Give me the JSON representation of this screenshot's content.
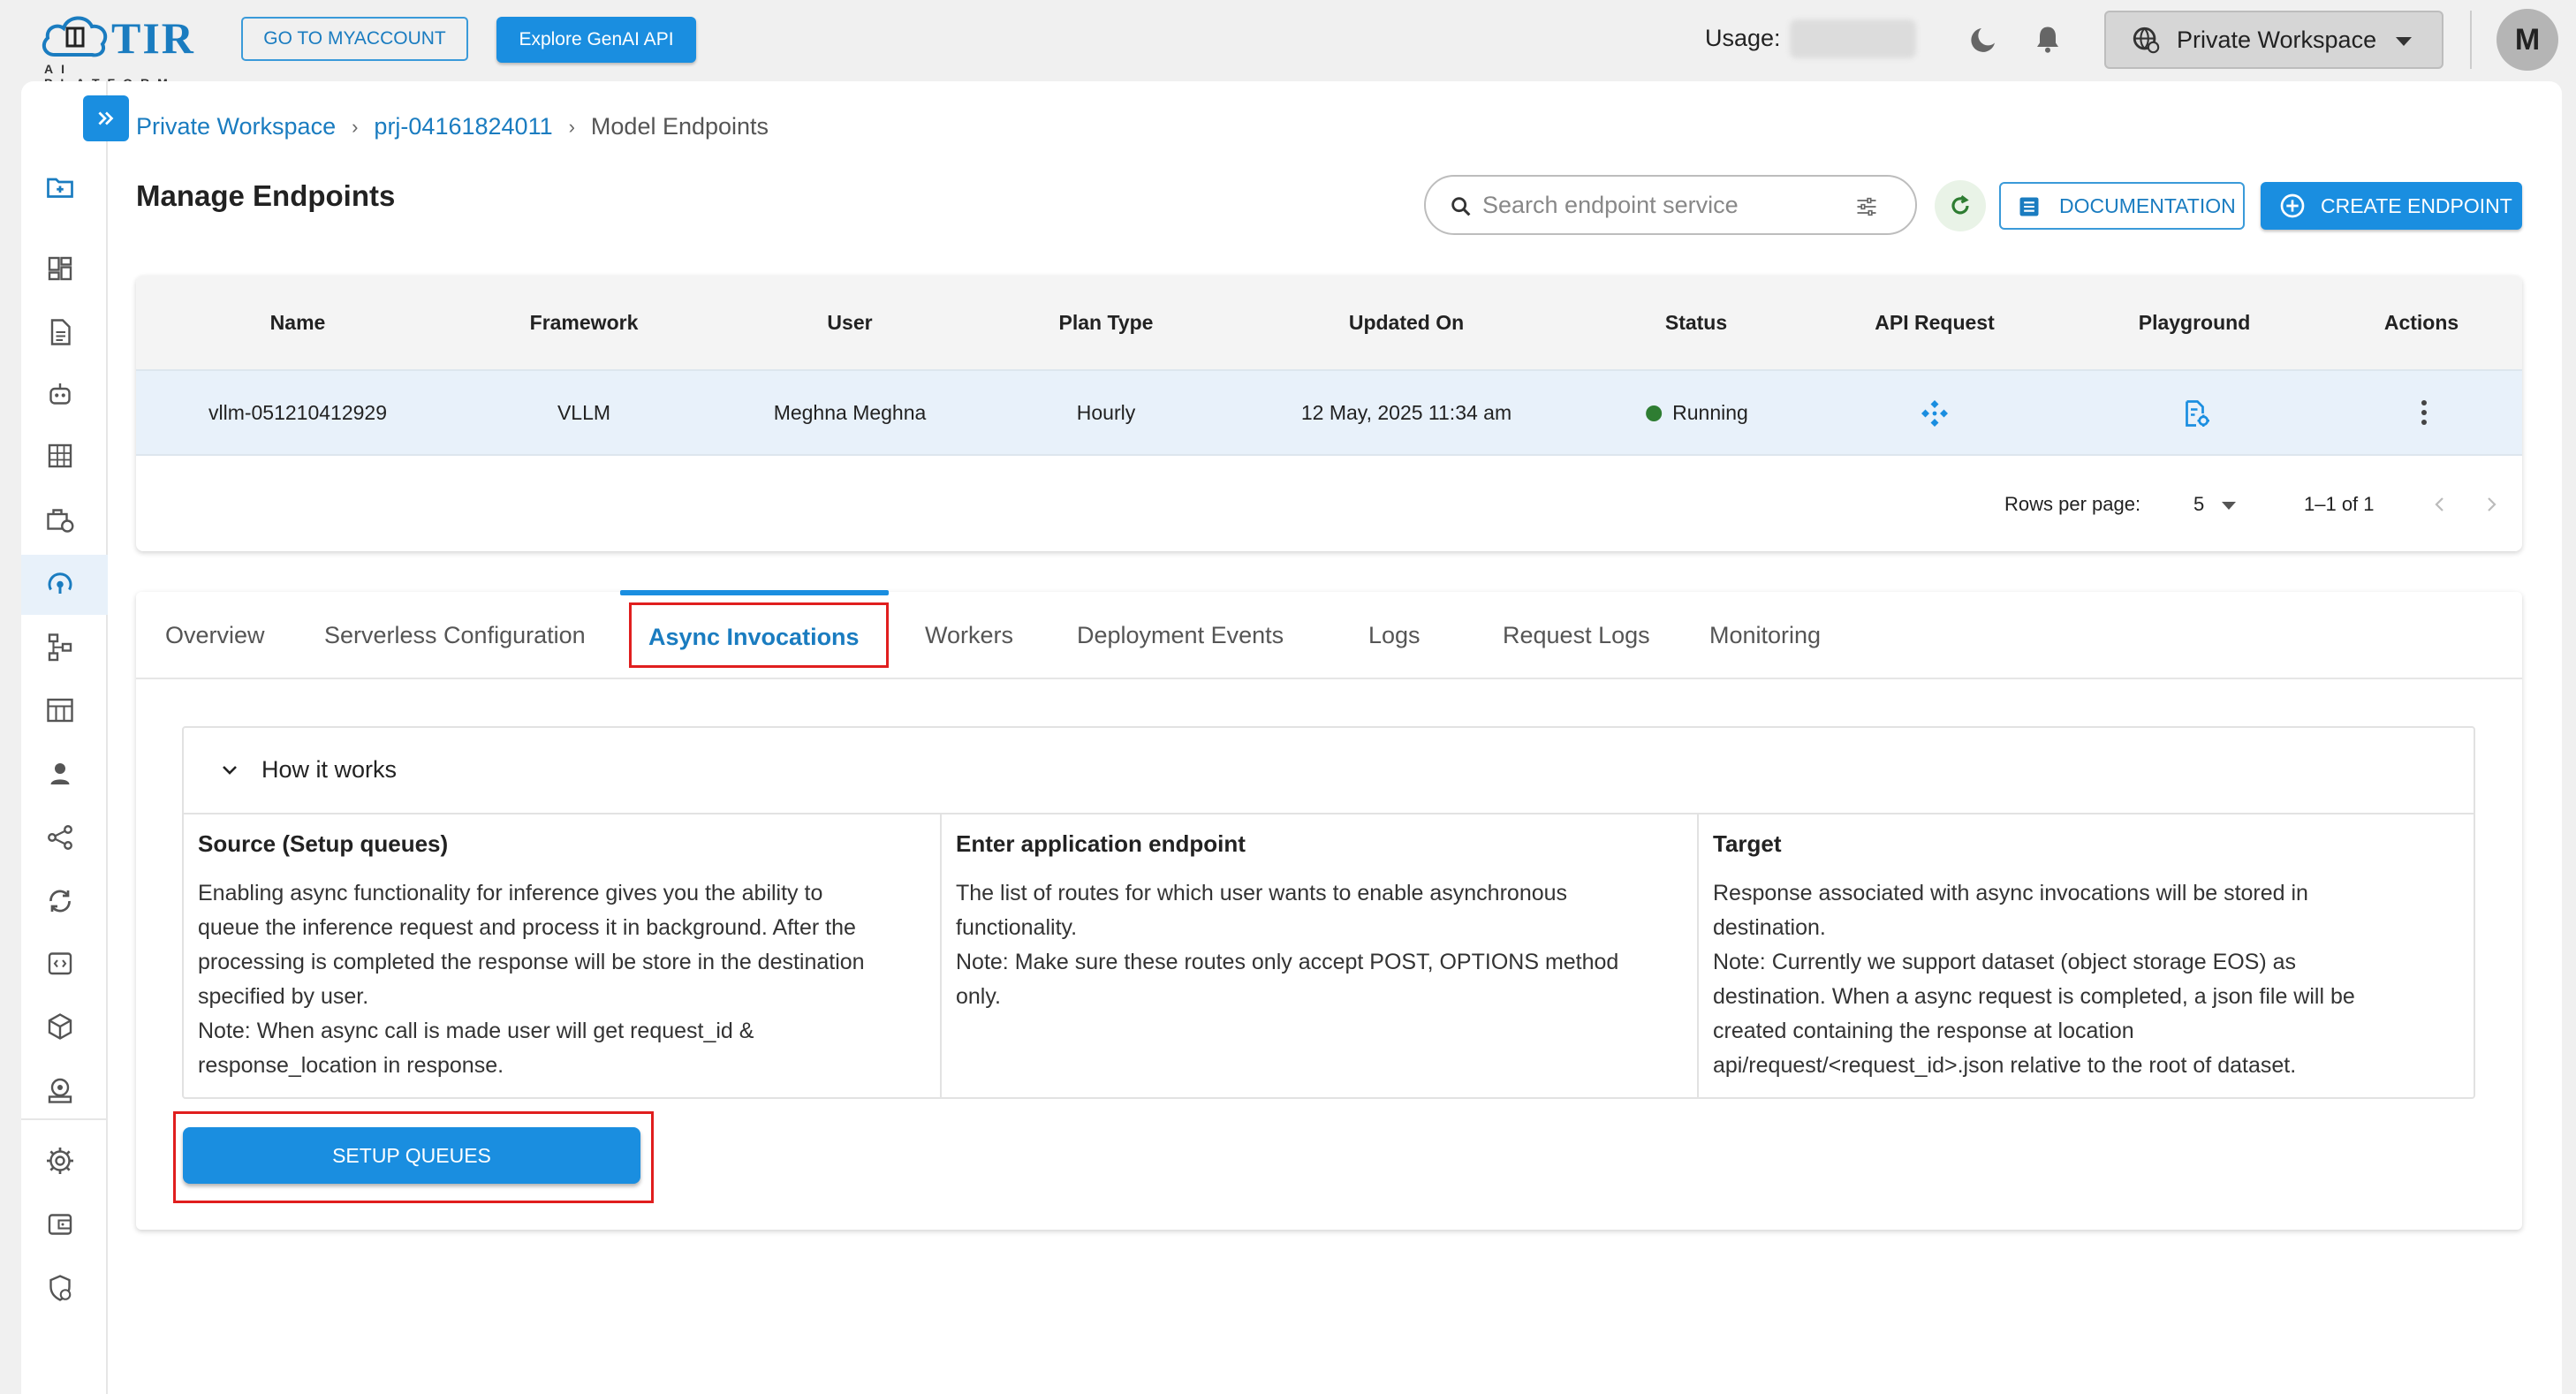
{
  "brand": {
    "name": "TIR",
    "subtitle": "AI PLATFORM"
  },
  "topbar": {
    "myaccount_label": "GO TO MYACCOUNT",
    "genai_label": "Explore GenAI API",
    "usage_label": "Usage:",
    "workspace_label": "Private Workspace",
    "avatar_initial": "M"
  },
  "breadcrumb": {
    "items": [
      "Private Workspace",
      "prj-04161824011",
      "Model Endpoints"
    ],
    "separator": "›"
  },
  "page": {
    "title": "Manage Endpoints"
  },
  "toolbar": {
    "search_placeholder": "Search endpoint service",
    "documentation_label": "DOCUMENTATION",
    "create_label": "CREATE ENDPOINT"
  },
  "table": {
    "headers": [
      "Name",
      "Framework",
      "User",
      "Plan Type",
      "Updated On",
      "Status",
      "API Request",
      "Playground",
      "Actions"
    ],
    "rows": [
      {
        "name": "vllm-051210412929",
        "framework": "VLLM",
        "user": "Meghna Meghna",
        "plan": "Hourly",
        "updated": "12 May, 2025 11:34 am",
        "status": "Running"
      }
    ],
    "pagination": {
      "rows_label": "Rows per page:",
      "rows_value": "5",
      "range": "1–1 of 1"
    }
  },
  "tabs": [
    {
      "label": "Overview"
    },
    {
      "label": "Serverless Configuration"
    },
    {
      "label": "Async Invocations",
      "active": true
    },
    {
      "label": "Workers"
    },
    {
      "label": "Deployment Events"
    },
    {
      "label": "Logs"
    },
    {
      "label": "Request Logs"
    },
    {
      "label": "Monitoring"
    }
  ],
  "how_it_works": {
    "title": "How it works",
    "columns": [
      {
        "title": "Source (Setup queues)",
        "lines": [
          "Enabling async functionality for inference gives you the ability to",
          "queue the inference request and process it in background. After the",
          "processing is completed the response will be store in the destination",
          "specified by user.",
          "Note: When async call is made user will get request_id &",
          "response_location in response."
        ]
      },
      {
        "title": "Enter application endpoint",
        "lines": [
          "The list of routes for which user wants to enable asynchronous",
          "functionality.",
          "Note: Make sure these routes only accept POST, OPTIONS method",
          "only."
        ]
      },
      {
        "title": "Target",
        "lines": [
          "Response associated with async invocations will be stored in",
          "destination.",
          "Note: Currently we support dataset (object storage EOS) as",
          "destination. When a async request is completed, a json file will be",
          "created containing the response at location",
          "api/request/<request_id>.json relative to the root of dataset."
        ]
      }
    ],
    "setup_label": "SETUP QUEUES"
  },
  "colors": {
    "accent": "#1a8ee0",
    "link": "#1a7cc0",
    "running": "#2e7d32",
    "highlight": "#e01e1e",
    "row_selected": "#e8f1fa"
  },
  "sidebar_icons": [
    "folder-plus-icon",
    "dashboard-icon",
    "document-icon",
    "robot-icon",
    "grid-icon",
    "toolbox-clock-icon",
    "endpoint-icon",
    "pipeline-icon",
    "table-icon",
    "user-stamp-icon",
    "share-nodes-icon",
    "sync-icon",
    "code-box-icon",
    "cube-icon",
    "monitor-icon",
    "gear-icon",
    "wallet-icon",
    "shield-icon"
  ]
}
